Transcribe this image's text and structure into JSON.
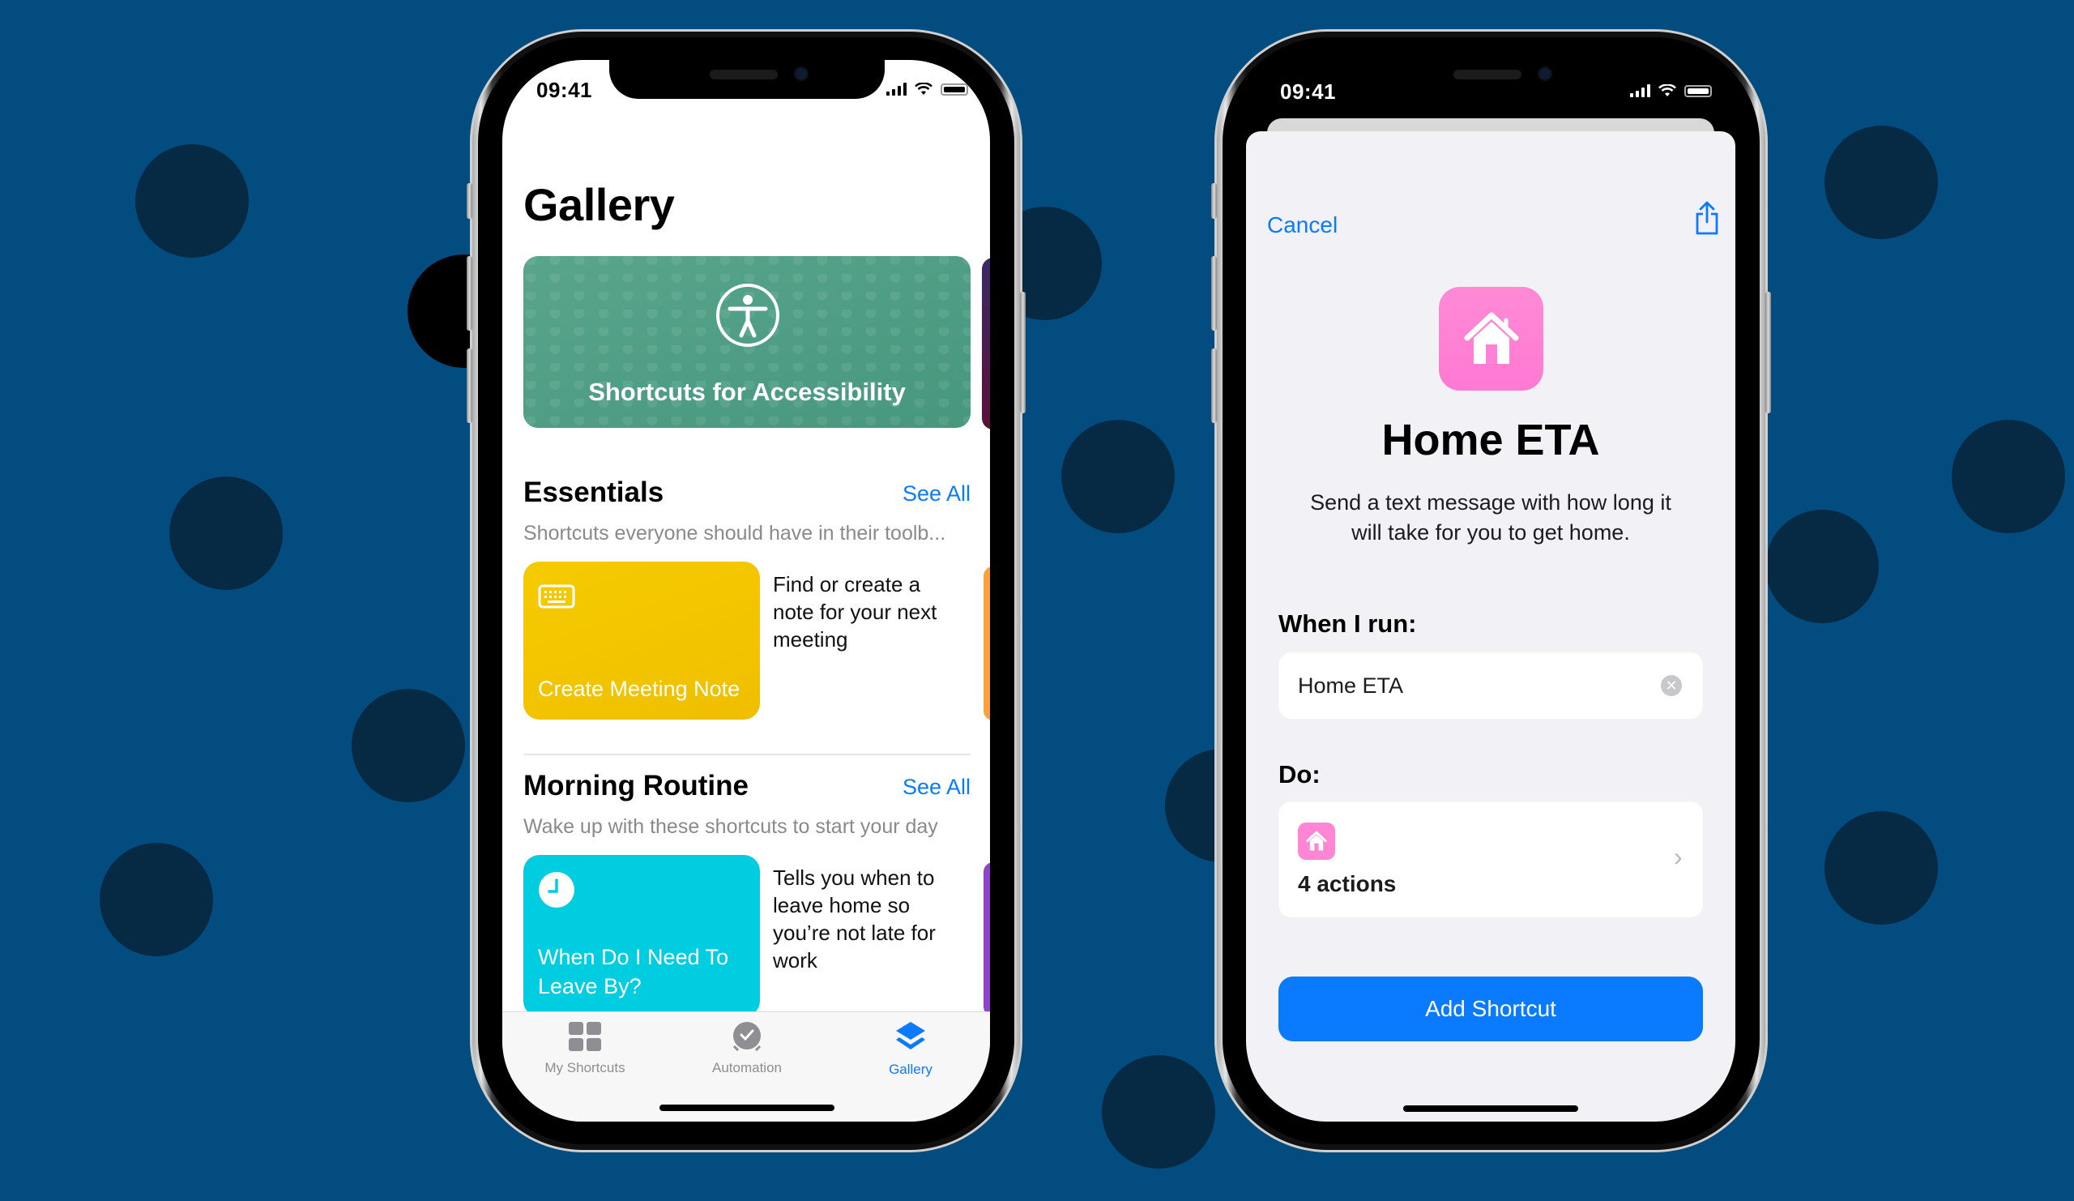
{
  "background": {
    "color": "#024c80",
    "dot_color": "#062944"
  },
  "left_phone": {
    "status_bar": {
      "time": "09:41"
    },
    "page_title": "Gallery",
    "banner": {
      "title": "Shortcuts for Accessibility",
      "icon": "accessibility-icon",
      "color": "#4f9e84"
    },
    "sections": [
      {
        "title": "Essentials",
        "see_all": "See All",
        "subtitle": "Shortcuts everyone should have in their toolb...",
        "card": {
          "title": "Create Meeting Note",
          "icon": "keyboard-icon",
          "color": "#f3c300",
          "description": "Find or create a note for your next meeting"
        },
        "peek_color": "#f7a23a"
      },
      {
        "title": "Morning Routine",
        "see_all": "See All",
        "subtitle": "Wake up with these shortcuts to start your day",
        "card": {
          "title": "When Do I Need To Leave By?",
          "icon": "clock-icon",
          "color": "#00cde0",
          "description": "Tells you when to leave home so you’re not late for work"
        },
        "peek_color": "#8e44c7"
      }
    ],
    "tab_bar": {
      "tabs": [
        {
          "label": "My Shortcuts",
          "icon": "grid-icon",
          "active": false
        },
        {
          "label": "Automation",
          "icon": "automation-clock-icon",
          "active": false
        },
        {
          "label": "Gallery",
          "icon": "layers-icon",
          "active": true
        }
      ],
      "active_color": "#0a7aff",
      "inactive_color": "#8e8e93"
    }
  },
  "right_phone": {
    "status_bar": {
      "time": "09:41"
    },
    "nav": {
      "cancel_label": "Cancel",
      "share_icon": "share-icon"
    },
    "shortcut": {
      "icon": "house-icon",
      "icon_color": "#ff82d6",
      "title": "Home ETA",
      "description": "Send a text message with how long it will take for you to get home."
    },
    "when_i_run": {
      "label": "When I run:",
      "value": "Home ETA"
    },
    "do": {
      "label": "Do:",
      "actions": "4 actions"
    },
    "add_button": {
      "label": "Add Shortcut",
      "color": "#0a7aff"
    }
  }
}
